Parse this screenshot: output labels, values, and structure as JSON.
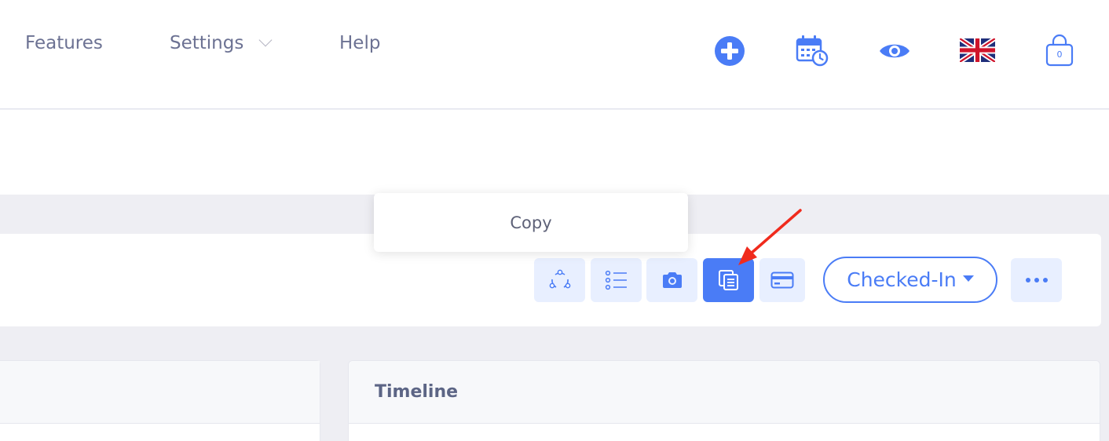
{
  "nav": {
    "features": "Features",
    "settings": "Settings",
    "help": "Help"
  },
  "top_icons": {
    "add": "plus-circle-icon",
    "calendar": "calendar-clock-icon",
    "view": "eye-icon",
    "language": "uk-flag-icon",
    "cart": "shopping-bag-icon",
    "cart_count": "0"
  },
  "toolbar": {
    "buttons": [
      {
        "icon": "share-nodes-icon",
        "active": false
      },
      {
        "icon": "list-icon",
        "active": false
      },
      {
        "icon": "camera-icon",
        "active": false
      },
      {
        "icon": "copy-icon",
        "active": true
      },
      {
        "icon": "credit-card-icon",
        "active": false
      }
    ],
    "status_label": "Checked-In",
    "more_icon": "more-dots-icon"
  },
  "tooltip": {
    "text": "Copy"
  },
  "panels": {
    "timeline_title": "Timeline"
  },
  "colors": {
    "accent": "#4a7cf6",
    "accent_light": "#e8efff",
    "annotation_arrow": "#f02b1d"
  }
}
